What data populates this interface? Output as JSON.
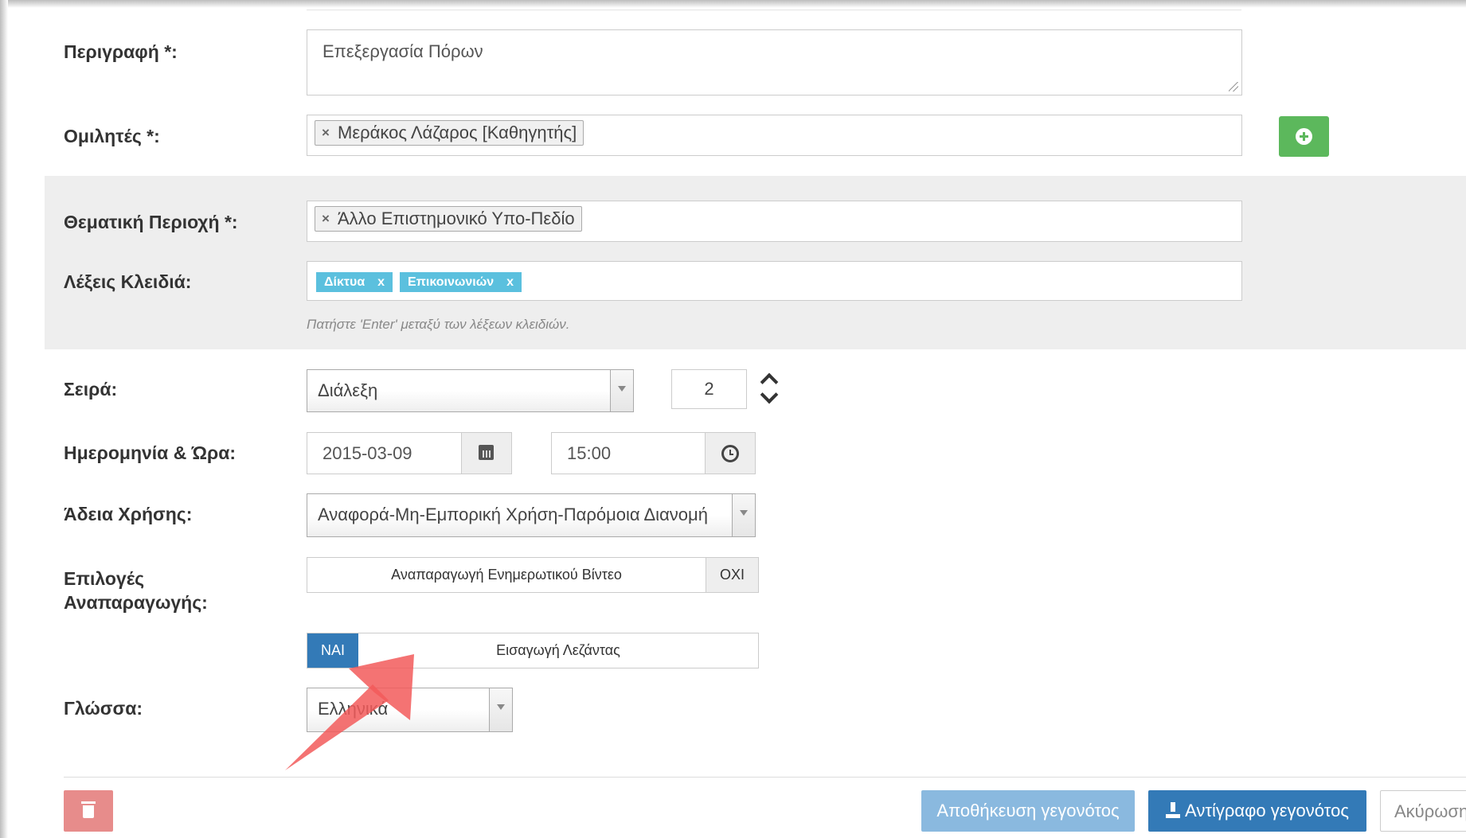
{
  "form": {
    "description": {
      "label": "Περιγραφή *:",
      "value": "Επεξεργασία Πόρων"
    },
    "speakers": {
      "label": "Ομιλητές *:",
      "chips": [
        "Μεράκος Λάζαρος [Καθηγητής]"
      ],
      "remove_glyph": "×"
    },
    "thematic_area": {
      "label": "Θεματική Περιοχή *:",
      "chips": [
        "Άλλο Επιστημονικό Υπο-Πεδίο"
      ],
      "remove_glyph": "×"
    },
    "keywords": {
      "label": "Λέξεις Κλειδιά:",
      "tags": [
        {
          "text": "Δίκτυα",
          "x": "x"
        },
        {
          "text": "Επικοινωνιών",
          "x": "x"
        }
      ],
      "help": "Πατήστε 'Enter' μεταξύ των λέξεων κλειδιών."
    },
    "series": {
      "label": "Σειρά:",
      "selected": "Διάλεξη",
      "number": "2"
    },
    "datetime": {
      "label": "Ημερομηνία & Ώρα:",
      "date": "2015-03-09",
      "time": "15:00"
    },
    "license": {
      "label": "Άδεια Χρήσης:",
      "selected": "Αναφορά-Μη-Εμπορική Χρήση-Παρόμοια Διανομή"
    },
    "playback": {
      "label_line1": "Επιλογές",
      "label_line2": "Αναπαραγωγής:",
      "option1": {
        "text": "Αναπαραγωγή Ενημερωτικού Βίντεο",
        "state": "ΟΧΙ"
      },
      "option2": {
        "text": "Εισαγωγή Λεζάντας",
        "state": "ΝΑΙ"
      }
    },
    "language": {
      "label": "Γλώσσα:",
      "selected": "Ελληνικά"
    }
  },
  "actions": {
    "save": "Αποθήκευση γεγονότος",
    "copy": "Αντίγραφο γεγονότος",
    "cancel": "Ακύρωση"
  },
  "colors": {
    "add_button": "#5cb85c",
    "keyword_tag": "#5bc0de",
    "toggle_on": "#337ab7",
    "delete_button": "#e78c8b",
    "save_button": "#8ab9df",
    "copy_button": "#337ab7",
    "annotation_arrow": "#f25a5a"
  },
  "icons": [
    "plus-circle-icon",
    "calendar-icon",
    "clock-icon",
    "chevron-up-icon",
    "chevron-down-icon",
    "trash-icon",
    "copy-icon"
  ]
}
